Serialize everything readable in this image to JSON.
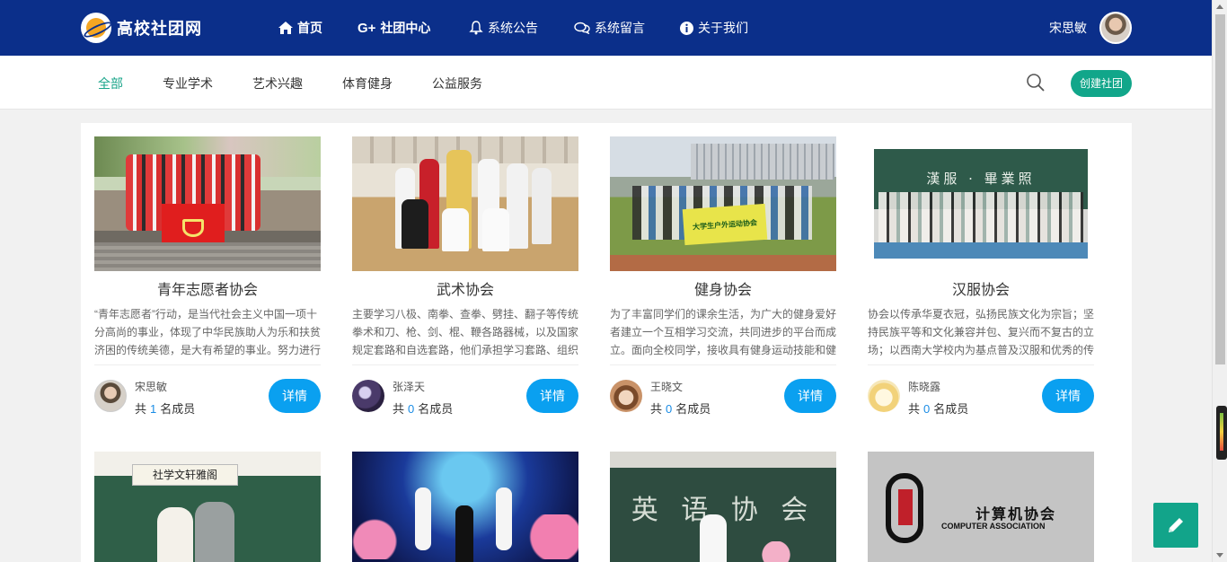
{
  "brand": {
    "title": "高校社团网"
  },
  "nav": [
    {
      "label": "首页",
      "icon": "home-icon"
    },
    {
      "label": "社团中心",
      "icon": "google-plus-icon"
    },
    {
      "label": "系统公告",
      "icon": "bell-icon"
    },
    {
      "label": "系统留言",
      "icon": "chat-icon"
    },
    {
      "label": "关于我们",
      "icon": "info-icon"
    }
  ],
  "user": {
    "name": "宋思敏"
  },
  "categories": [
    "全部",
    "专业学术",
    "艺术兴趣",
    "体育健身",
    "公益服务"
  ],
  "active_category": "全部",
  "create_button": "创建社团",
  "card_common": {
    "detail": "详情",
    "members_prefix": "共",
    "members_suffix": "名成员"
  },
  "clubs": [
    {
      "name": "青年志愿者协会",
      "desc": "“青年志愿者”行动，是当代社会主义中国一项十分高尚的事业，体现了中华民族助人为乐和扶贫济困的传统美德，是大有希望的事业。努力进行",
      "owner": "宋思敏",
      "members": "1"
    },
    {
      "name": "武术协会",
      "desc": "主要学习八极、南拳、查拳、劈挂、翻子等传统拳术和刀、枪、剑、棍、鞭各路器械，以及国家规定套路和自选套路，他们承担学习套路、组织",
      "owner": "张泽天",
      "members": "0"
    },
    {
      "name": "健身协会",
      "desc": "为了丰富同学们的课余生活，为广大的健身爱好者建立一个互相学习交流，共同进步的平台而成立。面向全校同学，接收具有健身运动技能和健",
      "owner": "王晓文",
      "members": "0"
    },
    {
      "name": "汉服协会",
      "desc": "协会以传承华夏衣冠，弘扬民族文化为宗旨；坚持民族平等和文化兼容并包、复兴而不复古的立场；以西南大学校内为基点普及汉服和优秀的传",
      "owner": "陈晓露",
      "members": "0"
    }
  ],
  "photo_text": {
    "hanfu_board": "漢服 · 畢業照",
    "banner_fitness": "大学生户外运动协会",
    "english_board": "英 语 协 会",
    "literature_board": "社学文轩雅阁",
    "computer_cn": "计算机协会",
    "computer_en": "COMPUTER ASSOCIATION"
  }
}
